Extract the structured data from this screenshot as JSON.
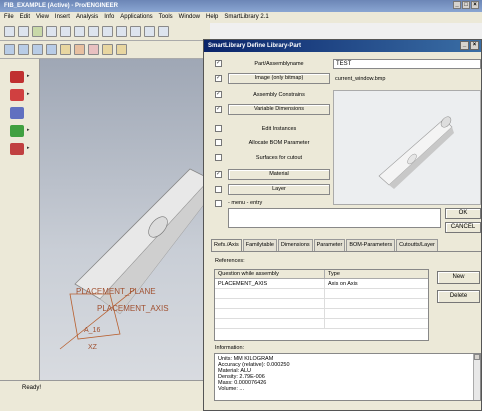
{
  "window": {
    "title": "FIB_EXAMPLE (Active) - Pro/ENGINEER"
  },
  "menu": [
    "File",
    "Edit",
    "View",
    "Insert",
    "Analysis",
    "Info",
    "Applications",
    "Tools",
    "Window",
    "Help",
    "SmartLibrary 2.1"
  ],
  "model": {
    "label_plane": "PLACEMENT_PLANE",
    "label_axis": "PLACEMENT_AXIS",
    "label_a": "A_16",
    "label_b": "XZ"
  },
  "status": {
    "text": "Ready!"
  },
  "dialog": {
    "title": "SmartLibrary Define Library-Part",
    "rows": [
      {
        "label": "Part/Assemblyname",
        "value": "TEST",
        "checked": true,
        "kind": "label"
      },
      {
        "label": "Image (only bitmap)",
        "value": "current_window.bmp",
        "checked": true,
        "kind": "button"
      },
      {
        "label": "Assembly Constrains",
        "checked": true,
        "kind": "label"
      },
      {
        "label": "Variable Dimensions",
        "checked": true,
        "kind": "button"
      },
      {
        "label": "Edit Instances",
        "checked": false,
        "kind": "label"
      },
      {
        "label": "Allocate BOM Parameter",
        "checked": false,
        "kind": "label"
      },
      {
        "label": "Surfaces for cutout",
        "checked": false,
        "kind": "label"
      },
      {
        "label": "Material",
        "checked": true,
        "kind": "button"
      },
      {
        "label": "Layer",
        "checked": false,
        "kind": "button"
      }
    ],
    "menu_entry_label": "- menu - entry",
    "ok_label": "OK",
    "cancel_label": "CANCEL",
    "tabs": [
      "Refs./Axis",
      "Familytable",
      "Dimensions",
      "Parameter",
      "BOM-Parameters",
      "Cutoutts/Layer"
    ],
    "references_label": "References:",
    "table": {
      "columns": [
        "Question while assembly",
        "Type"
      ],
      "rows": [
        [
          "PLACEMENT_AXIS",
          "Axis on Axis"
        ]
      ]
    },
    "new_label": "New",
    "delete_label": "Delete",
    "information_label": "Information:",
    "info_lines": [
      "Units: MM KILOGRAM",
      "Accuracy (relative): 0.000250",
      "Material: ALU",
      "Density: 2.79E-006",
      "Mass: 0.000076426",
      "Volume: ..."
    ]
  },
  "colors": {
    "dialog_title": "#0a246a",
    "window_title": "#7a94c2",
    "canvas": "#b9c0cc"
  }
}
